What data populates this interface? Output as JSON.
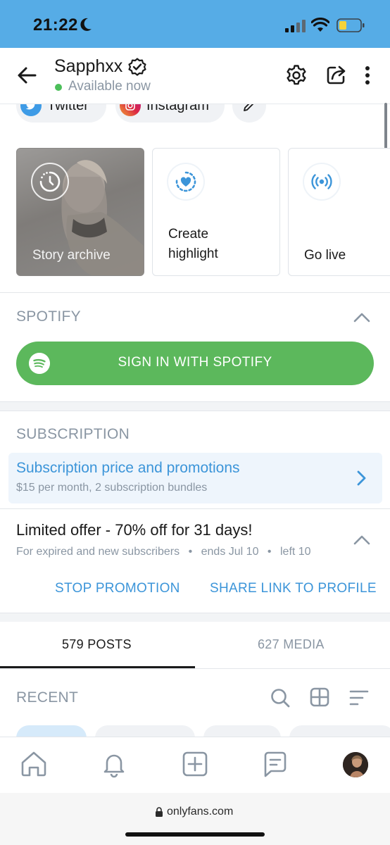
{
  "status_bar": {
    "time": "21:22"
  },
  "header": {
    "profile_name": "Sapphxx",
    "availability": "Available now"
  },
  "social_links": [
    {
      "label": "Twitter"
    },
    {
      "label": "Instagram"
    }
  ],
  "story_cards": [
    {
      "label": "Story archive"
    },
    {
      "label": "Create highlight"
    },
    {
      "label": "Go live"
    }
  ],
  "spotify": {
    "title": "SPOTIFY",
    "button_label": "SIGN IN WITH SPOTIFY"
  },
  "subscription": {
    "title": "SUBSCRIPTION",
    "row_title": "Subscription price and promotions",
    "row_desc": "$15 per month, 2 subscription bundles"
  },
  "offer": {
    "title": "Limited offer - 70% off for 31 days!",
    "audience": "For expired and new subscribers",
    "ends": "ends Jul 10",
    "left": "left 10",
    "stop_label": "STOP PROMOTION",
    "share_label": "SHARE LINK TO PROFILE"
  },
  "tabs": [
    {
      "label": "579 POSTS"
    },
    {
      "label": "627 MEDIA"
    }
  ],
  "recent": {
    "title": "RECENT"
  },
  "browser": {
    "url": "onlyfans.com"
  },
  "colors": {
    "status_bar": "#56ace6",
    "accent_blue": "#3c95d9",
    "spotify_green": "#5cb85c",
    "online_green": "#4cbf5a",
    "muted_text": "#8a96a3"
  }
}
